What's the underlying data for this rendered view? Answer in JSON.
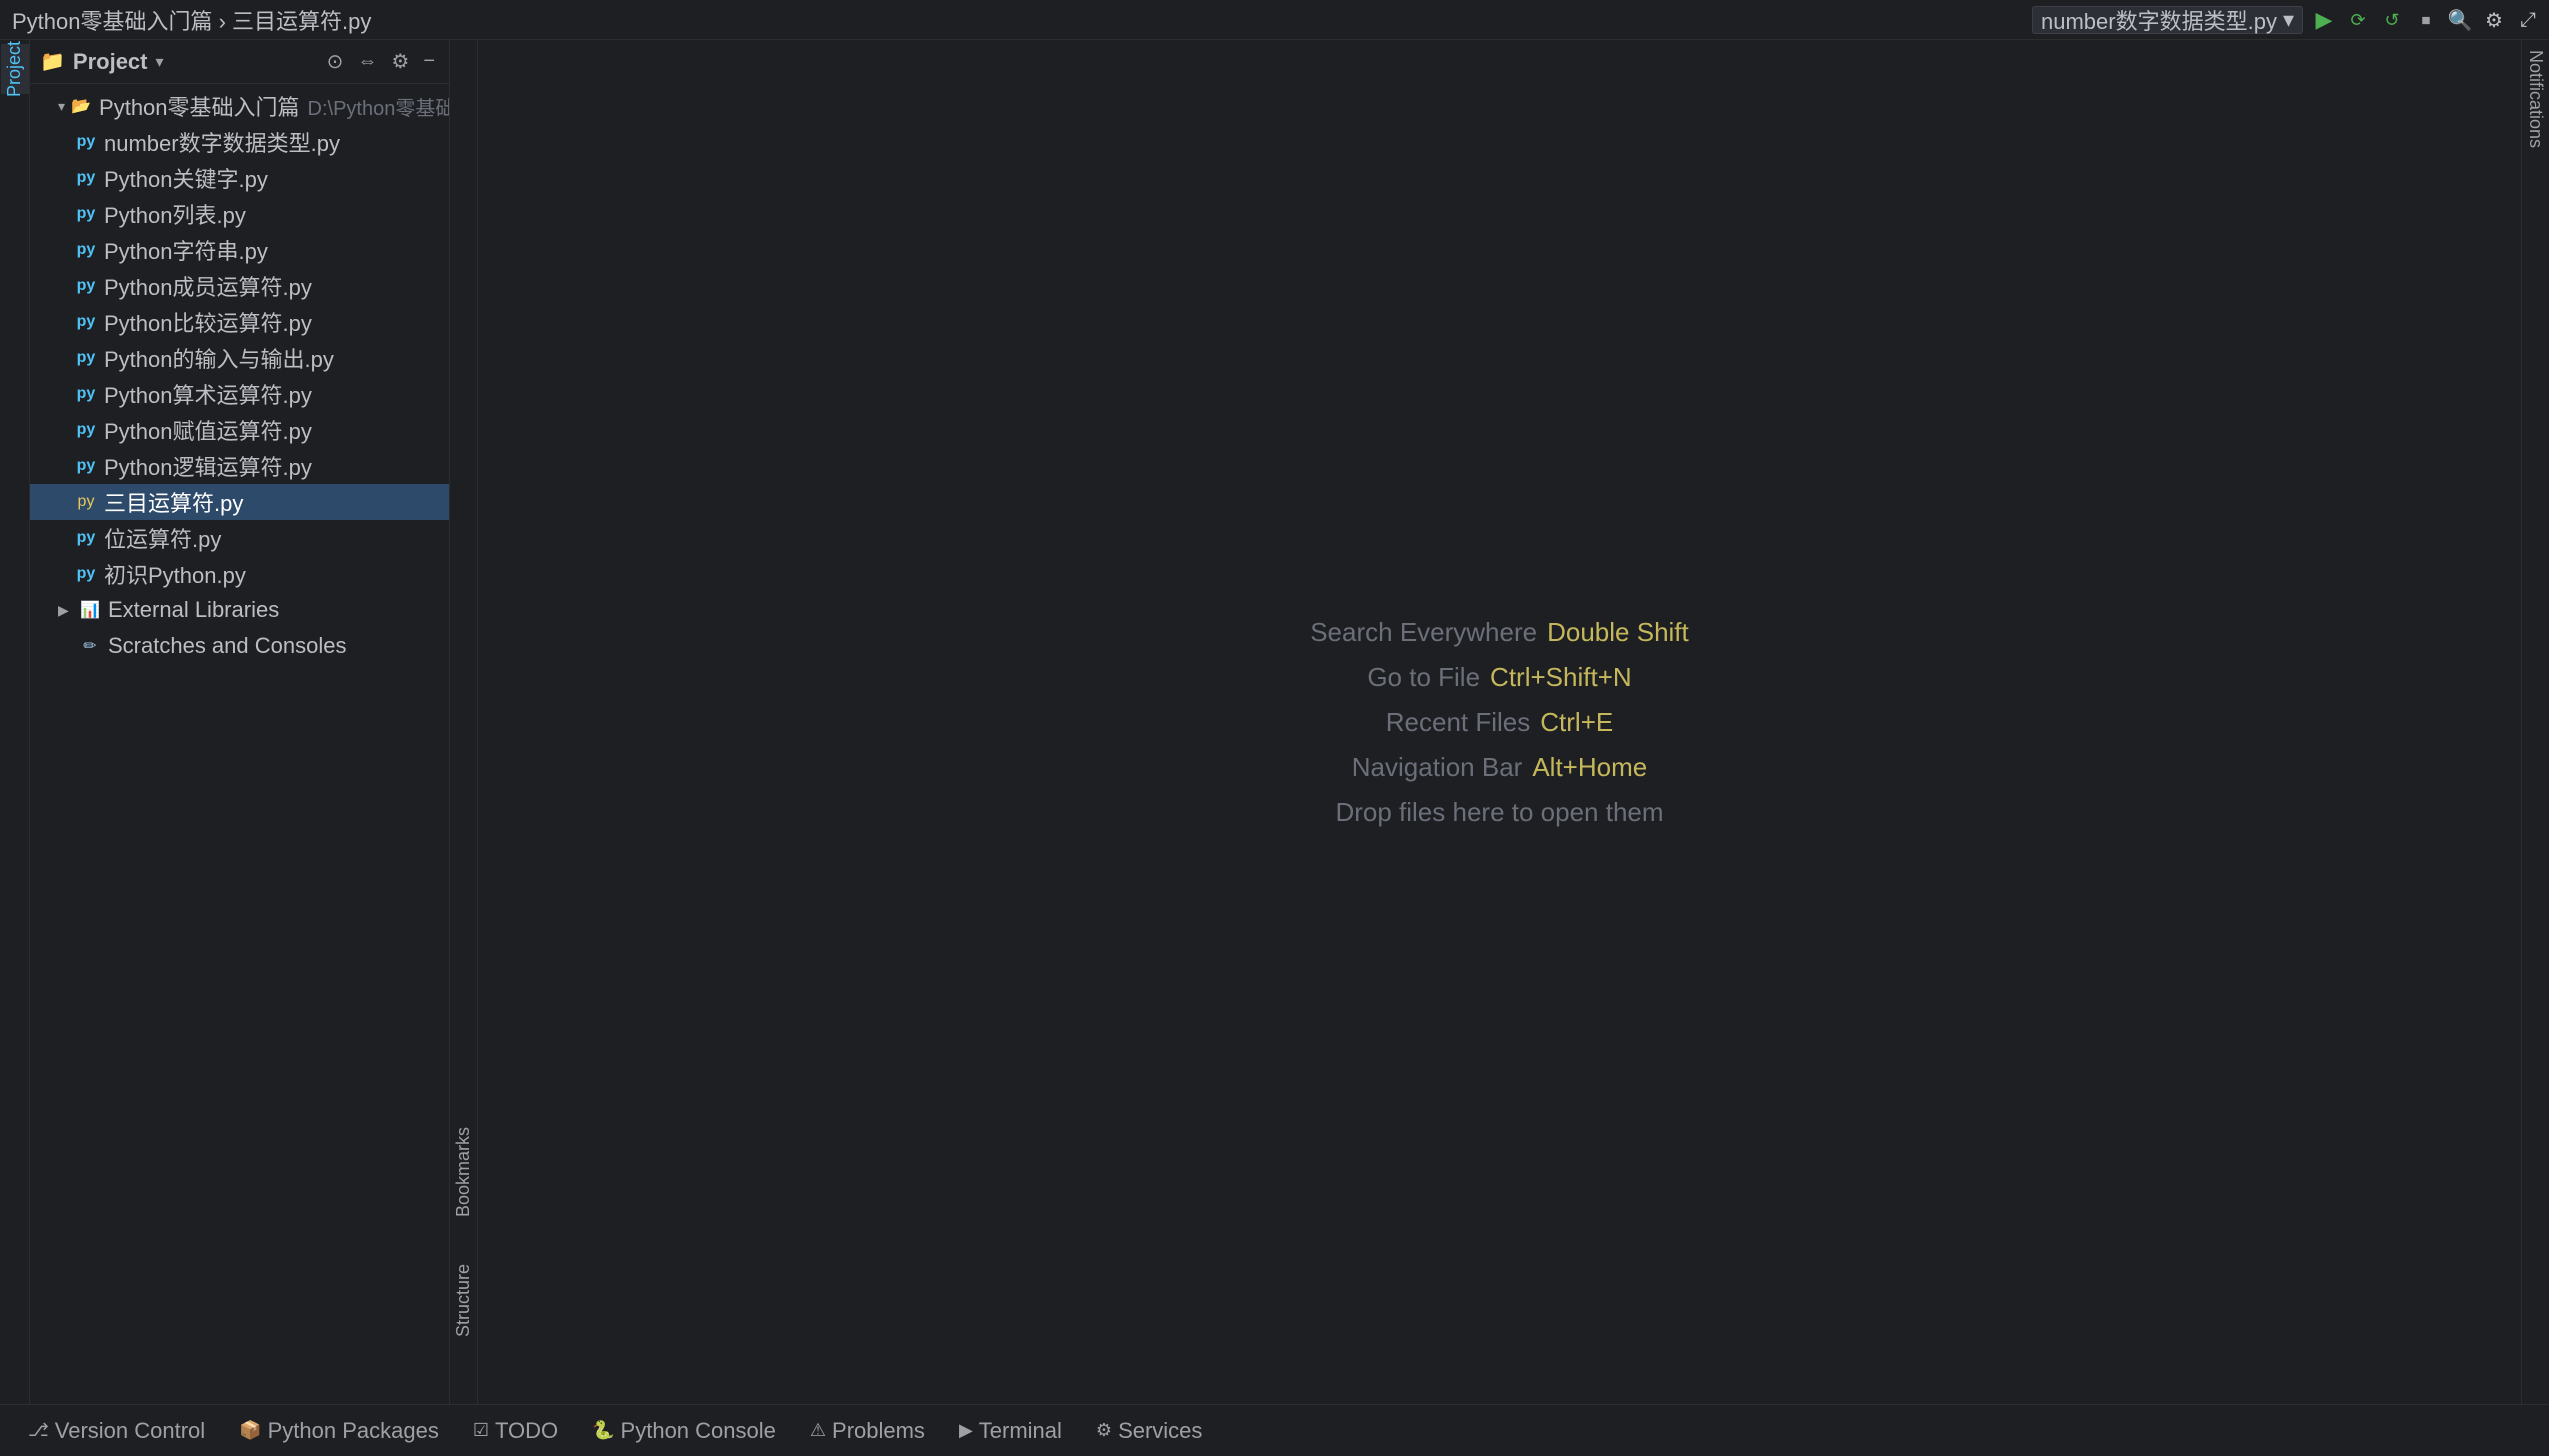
{
  "titlebar": {
    "title": "Python零基础入门篇  ›  三目运算符.py",
    "run_config": "number数字数据类型.py",
    "chevron": "▾"
  },
  "titlebar_buttons": [
    {
      "name": "avatar-icon",
      "label": "👤"
    },
    {
      "name": "run-button",
      "label": "▶"
    },
    {
      "name": "debug-button",
      "label": "🐞"
    },
    {
      "name": "coverage-button",
      "label": "📊"
    },
    {
      "name": "stop-button",
      "label": "⏹"
    },
    {
      "name": "search-button",
      "label": "🔍"
    },
    {
      "name": "settings-button",
      "label": "⚙"
    },
    {
      "name": "maximize-button",
      "label": "⤢"
    }
  ],
  "sidebar": {
    "title": "Project",
    "project_root": "Python零基础入门篇",
    "project_path": "D:\\Python零基础入门篇",
    "files": [
      {
        "name": "number数字数据类型.py",
        "type": "py",
        "indent": 2
      },
      {
        "name": "Python关键字.py",
        "type": "py",
        "indent": 2
      },
      {
        "name": "Python列表.py",
        "type": "py",
        "indent": 2
      },
      {
        "name": "Python字符串.py",
        "type": "py",
        "indent": 2
      },
      {
        "name": "Python成员运算符.py",
        "type": "py",
        "indent": 2
      },
      {
        "name": "Python比较运算符.py",
        "type": "py",
        "indent": 2
      },
      {
        "name": "Python的输入与输出.py",
        "type": "py",
        "indent": 2
      },
      {
        "name": "Python算术运算符.py",
        "type": "py",
        "indent": 2
      },
      {
        "name": "Python赋值运算符.py",
        "type": "py",
        "indent": 2
      },
      {
        "name": "Python逻辑运算符.py",
        "type": "py",
        "indent": 2
      },
      {
        "name": "三目运算符.py",
        "type": "py-active",
        "indent": 2,
        "selected": true
      },
      {
        "name": "位运算符.py",
        "type": "py",
        "indent": 2
      },
      {
        "name": "初识Python.py",
        "type": "py",
        "indent": 2
      }
    ],
    "external_libraries": "External Libraries",
    "scratches": "Scratches and Consoles"
  },
  "editor": {
    "hint1_label": "Search Everywhere",
    "hint1_shortcut": "Double Shift",
    "hint2_label": "Go to File",
    "hint2_shortcut": "Ctrl+Shift+N",
    "hint3_label": "Recent Files",
    "hint3_shortcut": "Ctrl+E",
    "hint4_label": "Navigation Bar",
    "hint4_shortcut": "Alt+Home",
    "hint5_label": "Drop files here to open them"
  },
  "activity_bar": {
    "items": [
      {
        "label": "Project",
        "active": true
      }
    ]
  },
  "right_bar": {
    "label": "Notifications"
  },
  "left_side_labels": [
    {
      "label": "Bookmarks"
    },
    {
      "label": "Structure"
    }
  ],
  "bottom_tabs": [
    {
      "icon": "⎇",
      "label": "Version Control"
    },
    {
      "icon": "📦",
      "label": "Python Packages"
    },
    {
      "icon": "☑",
      "label": "TODO"
    },
    {
      "icon": "🐍",
      "label": "Python Console"
    },
    {
      "icon": "⚠",
      "label": "Problems"
    },
    {
      "icon": "▶",
      "label": "Terminal"
    },
    {
      "icon": "⚙",
      "label": "Services"
    }
  ]
}
